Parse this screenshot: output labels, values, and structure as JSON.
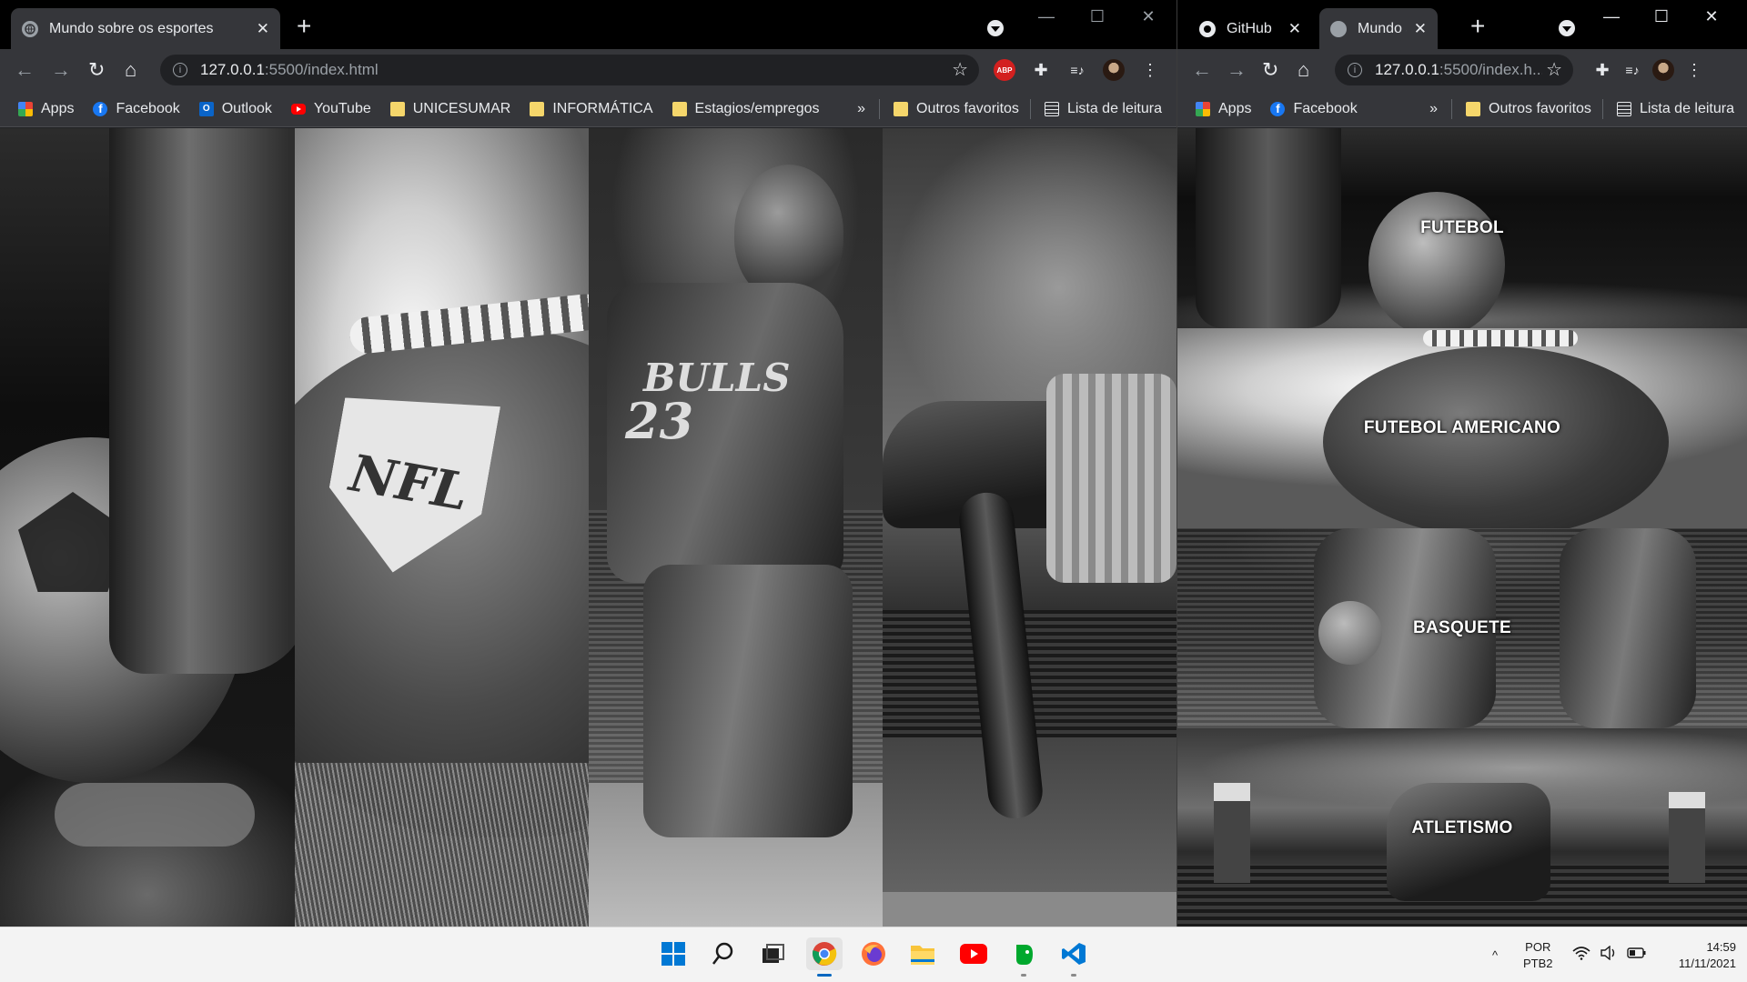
{
  "left_window": {
    "tab": {
      "title": "Mundo sobre os esportes",
      "close": "✕"
    },
    "new_tab": "+",
    "window_controls": {
      "minimize": "—",
      "maximize": "☐",
      "close": "✕"
    },
    "nav": {
      "back": "←",
      "forward": "→",
      "reload": "↻",
      "home": "⌂"
    },
    "address": {
      "host": "127.0.0.1",
      "path": ":5500/index.html",
      "star": "☆"
    },
    "extensions": {
      "abp": "ABP",
      "puzzle": "✚",
      "reading": "≡♪",
      "menu": "⋮"
    },
    "bookmarks": [
      {
        "label": "Apps",
        "icon": "apps-grid-icon"
      },
      {
        "label": "Facebook",
        "icon": "facebook-icon"
      },
      {
        "label": "Outlook",
        "icon": "outlook-icon"
      },
      {
        "label": "YouTube",
        "icon": "youtube-icon"
      },
      {
        "label": "UNICESUMAR",
        "icon": "folder-icon"
      },
      {
        "label": "INFORMÁTICA",
        "icon": "folder-icon"
      },
      {
        "label": "Estagios/empregos",
        "icon": "folder-icon"
      }
    ],
    "bookmarks_more": "»",
    "other_favorites": "Outros favoritos",
    "reading_list": "Lista de leitura"
  },
  "right_window": {
    "tabs": [
      {
        "title": "GitHub",
        "close": "✕"
      },
      {
        "title": "Mundo so",
        "close": "✕"
      }
    ],
    "new_tab": "+",
    "window_controls": {
      "minimize": "—",
      "maximize": "☐",
      "close": "✕"
    },
    "nav": {
      "back": "←",
      "forward": "→",
      "reload": "↻",
      "home": "⌂"
    },
    "address": {
      "host": "127.0.0.1",
      "path": ":5500/index.h...",
      "star": "☆"
    },
    "extensions": {
      "puzzle": "✚",
      "reading": "≡♪",
      "menu": "⋮"
    },
    "bookmarks": [
      {
        "label": "Apps",
        "icon": "apps-grid-icon"
      },
      {
        "label": "Facebook",
        "icon": "facebook-icon"
      }
    ],
    "bookmarks_more": "»",
    "other_favorites": "Outros favoritos",
    "reading_list": "Lista de leitura",
    "sports": [
      "FUTEBOL",
      "FUTEBOL AMERICANO",
      "BASQUETE",
      "ATLETISMO"
    ]
  },
  "page_logos": {
    "nfl": "NFL",
    "bulls_number": "23",
    "bulls": "BULLS"
  },
  "taskbar": {
    "apps": [
      "windows-start-icon",
      "search-icon",
      "task-view-icon",
      "chrome-icon",
      "firefox-icon",
      "file-explorer-icon",
      "youtube-icon",
      "evernote-icon",
      "vscode-icon"
    ],
    "tray": {
      "chevron": "^",
      "lang_top": "POR",
      "lang_bottom": "PTB2",
      "time": "14:59",
      "date": "11/11/2021"
    }
  },
  "colors": {
    "tab_active": "#35363a",
    "chrome_dark": "#202124",
    "accent_blue": "#0067c0",
    "abp_red": "#d3201f"
  }
}
